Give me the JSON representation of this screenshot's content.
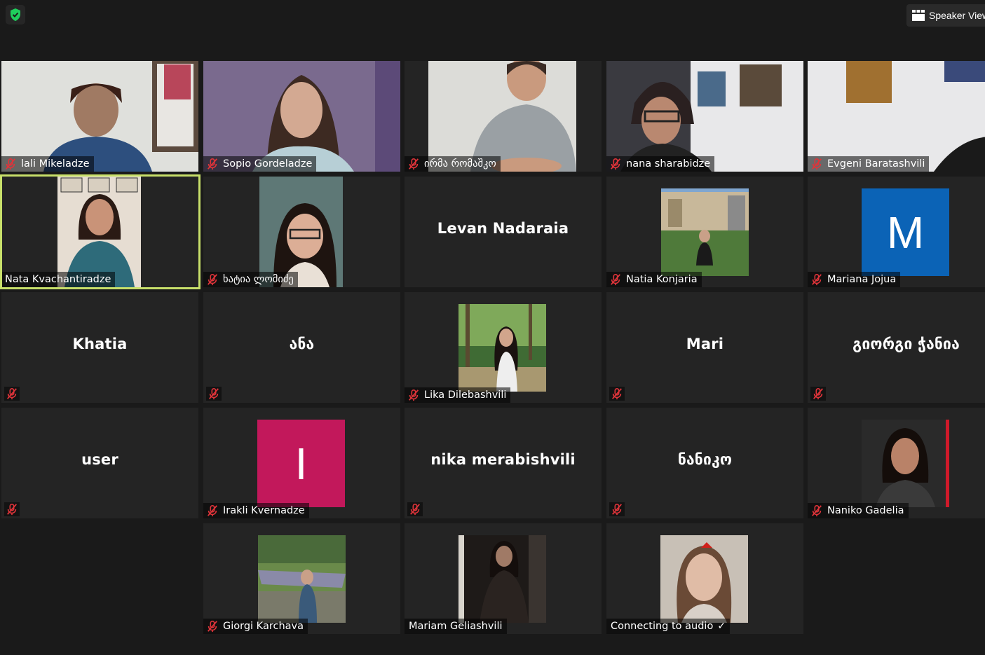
{
  "topbar": {
    "speaker_view_label": "Speaker View"
  },
  "colors": {
    "background": "#1a1a1a",
    "tile": "#242424",
    "active_border": "#e6f07a",
    "mute_red": "#e0343a",
    "shield_green": "#1fcf5c",
    "avatar_blue": "#0b63b6",
    "avatar_magenta": "#c2185b"
  },
  "participants": [
    {
      "name": "lali Mikeladze",
      "muted": true,
      "video": true
    },
    {
      "name": "Sopio Gordeladze",
      "muted": true,
      "video": true
    },
    {
      "name": "ირმა რომაშკო",
      "muted": true,
      "video": true
    },
    {
      "name": "nana sharabidze",
      "muted": true,
      "video": true
    },
    {
      "name": "Evgeni Baratashvili",
      "muted": true,
      "video": true
    },
    {
      "name": "Nata Kvachantiradze",
      "muted": false,
      "video": true,
      "active_speaker": true
    },
    {
      "name": "ხატია ლომიძე",
      "muted": true,
      "video": true
    },
    {
      "name": "Levan Nadaraia",
      "muted": false,
      "video": false
    },
    {
      "name": "Natia Konjaria",
      "muted": true,
      "video": true
    },
    {
      "name": "Mariana Jojua",
      "muted": true,
      "avatar_letter": "M"
    },
    {
      "name": "Khatia",
      "muted": true,
      "video": false
    },
    {
      "name": "ანა",
      "muted": true,
      "video": false
    },
    {
      "name": "Lika Dilebashvili",
      "muted": true,
      "video": true
    },
    {
      "name": "Mari",
      "muted": true,
      "video": false
    },
    {
      "name": "გიორგი ჭანია",
      "muted": true,
      "video": false
    },
    {
      "name": "user",
      "muted": true,
      "video": false
    },
    {
      "name": "Irakli Kvernadze",
      "muted": true,
      "avatar_letter": "I"
    },
    {
      "name": "nika merabishvili",
      "muted": true,
      "video": false
    },
    {
      "name": "ნანიკო",
      "muted": true,
      "video": false
    },
    {
      "name": "Naniko Gadelia",
      "muted": true,
      "video": true
    },
    {
      "name": "Giorgi Karchava",
      "muted": true,
      "video": true
    },
    {
      "name": "Mariam Geliashvili",
      "muted": false,
      "video": true
    },
    {
      "name": "Connecting to audio",
      "muted": false,
      "video": true,
      "status_icon": "checkmark-icon"
    }
  ]
}
